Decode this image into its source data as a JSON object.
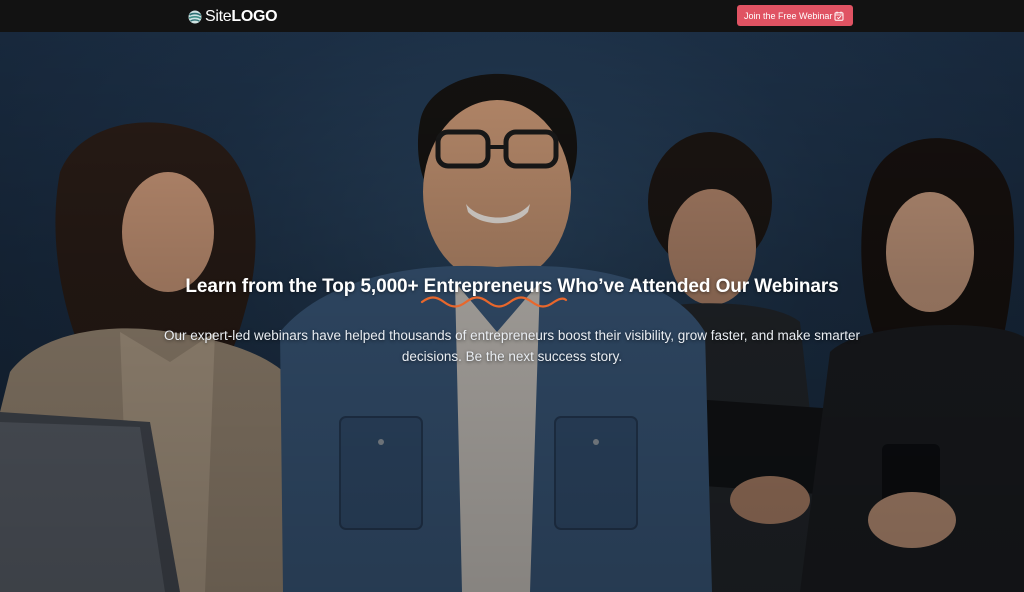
{
  "header": {
    "logo": {
      "site": "Site",
      "logo": "LOGO",
      "icon": "globe-swirl-icon"
    },
    "cta": {
      "label": "Join the Free Webinar",
      "icon": "calendar-check-icon",
      "color": "#e05363"
    }
  },
  "hero": {
    "title": "Learn from the Top 5,000+ Entrepreneurs Who’ve Attended Our Webinars",
    "subtitle": "Our expert-led webinars have helped thousands of entrepreneurs boost their visibility, grow faster, and make smarter decisions. Be the next success story.",
    "accent_color": "#e8672c",
    "image": "group-of-four-smiling-people-with-devices"
  }
}
